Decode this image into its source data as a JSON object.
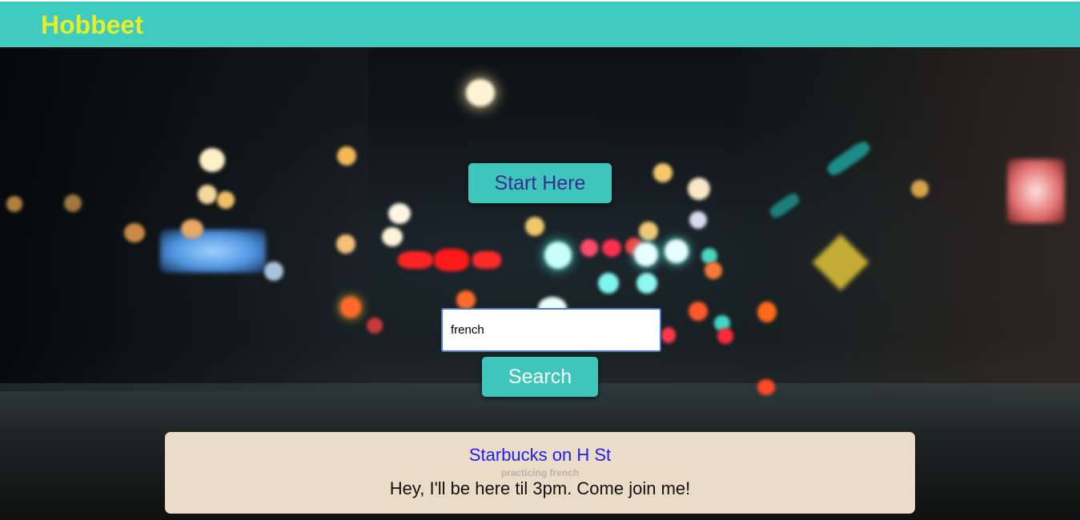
{
  "header": {
    "brand": "Hobbeet",
    "background_color": "#3fcbc0",
    "brand_color": "#e6ee2a"
  },
  "hero": {
    "start_button_label": "Start Here",
    "search": {
      "value": "french",
      "placeholder": ""
    },
    "search_button_label": "Search"
  },
  "results": [
    {
      "place": "Starbucks on H St",
      "activity": "practicing french",
      "message": "Hey, I'll be here til 3pm. Come join me!"
    }
  ],
  "colors": {
    "button_bg": "#3fc6bc",
    "start_label": "#3b2c8f",
    "card_bg": "#ebdcc8",
    "link": "#1f1ef0"
  }
}
